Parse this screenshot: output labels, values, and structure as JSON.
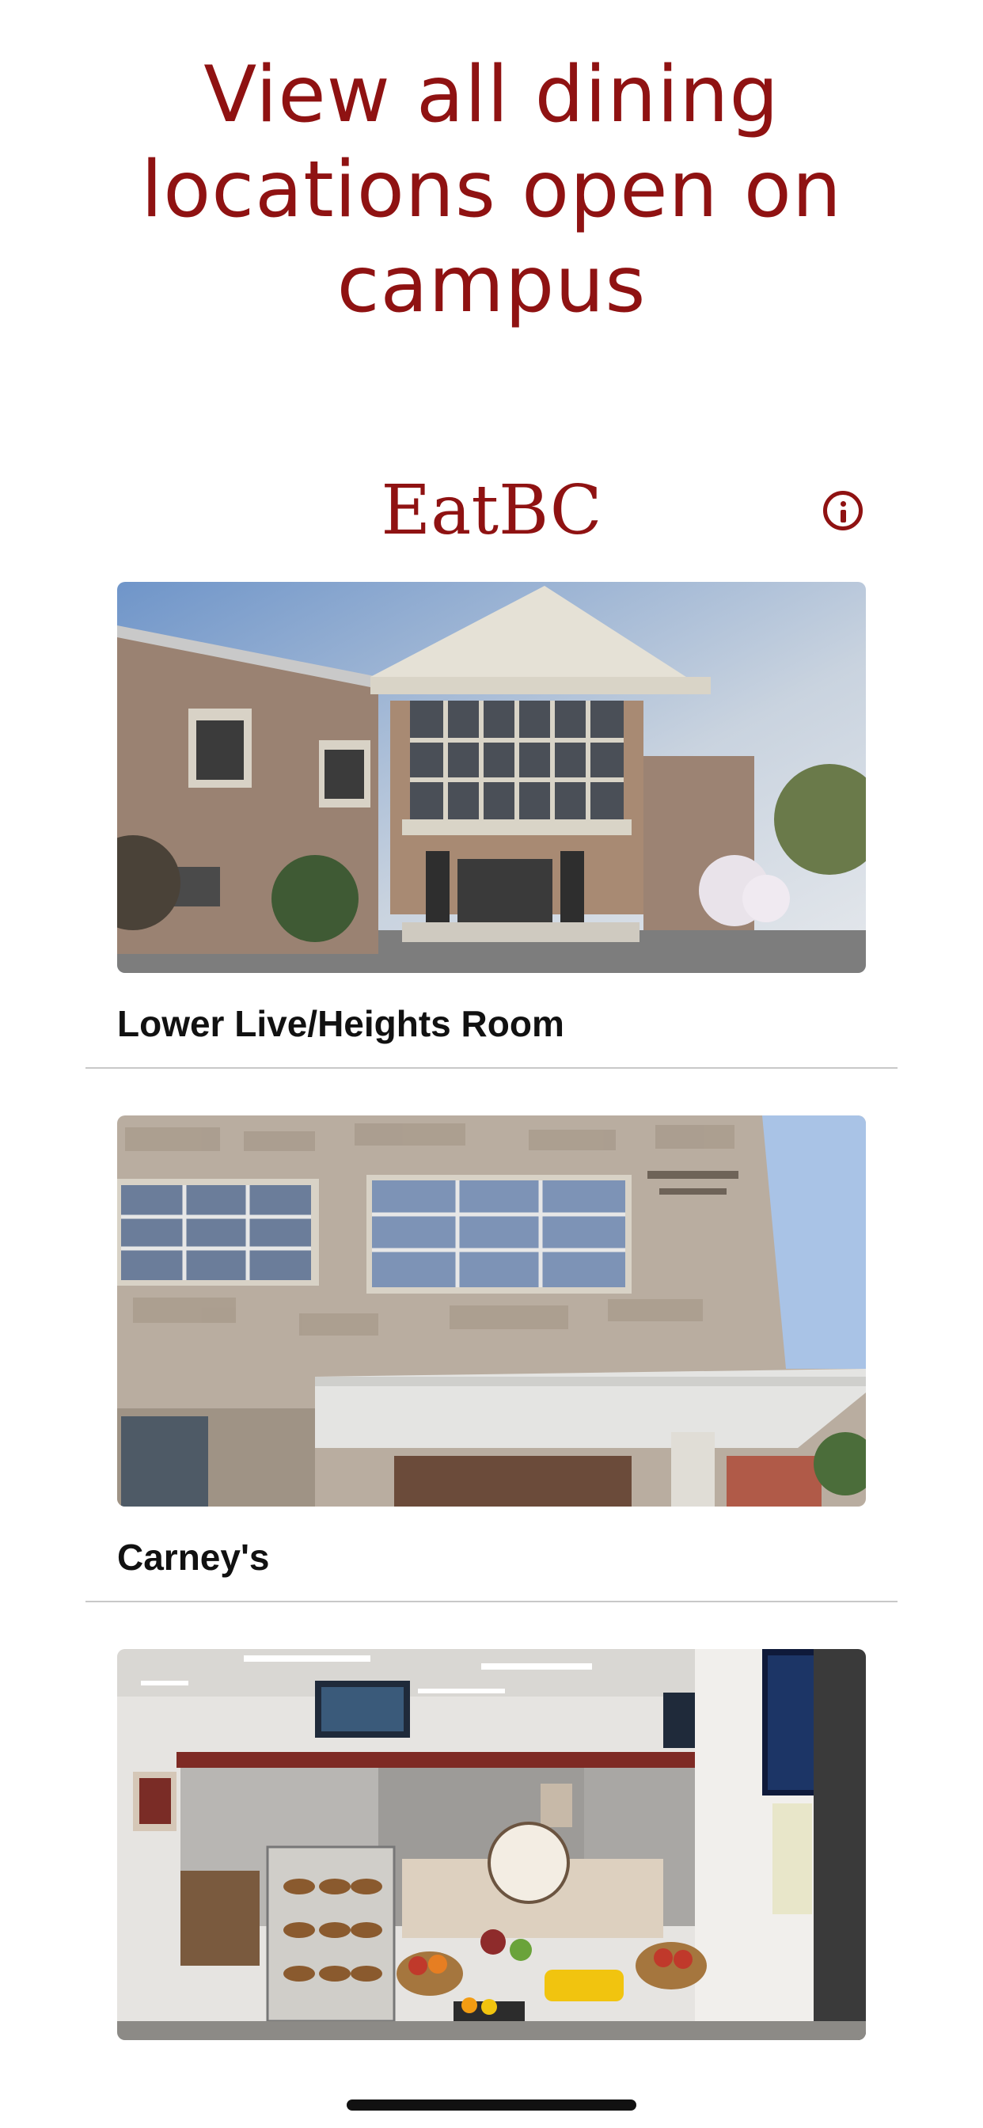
{
  "promo": {
    "line1": "View all dining",
    "line2": "locations open on",
    "line3": "campus"
  },
  "header": {
    "title": "EatBC",
    "info_icon": "info-circle-icon"
  },
  "locations": [
    {
      "name": "Lower Live/Heights Room"
    },
    {
      "name": "Carney's"
    },
    {
      "name": ""
    }
  ],
  "colors": {
    "brand": "#8f1212",
    "divider": "#c8c8c8"
  }
}
